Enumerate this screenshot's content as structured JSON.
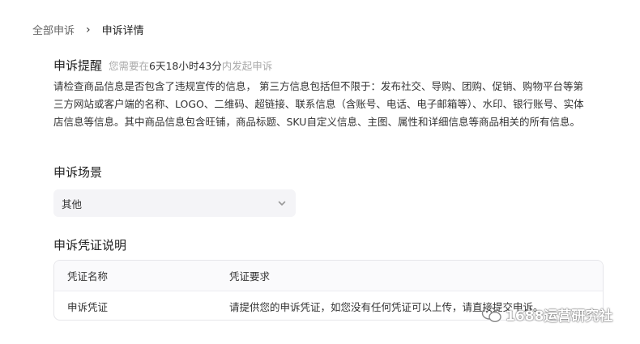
{
  "breadcrumb": {
    "parent": "全部申诉",
    "separator": "›",
    "current": "申诉详情"
  },
  "reminder": {
    "title": "申诉提醒",
    "countdown_prefix": "您需要在",
    "countdown_time": "6天18小时43分",
    "countdown_suffix": "内发起申诉",
    "body": " 请检查商品信息是否包含了违规宣传的信息， 第三方信息包括但不限于：发布社交、导购、团购、促销、购物平台等第三方网站或客户端的名称、LOGO、二维码、超链接、联系信息（含账号、电话、电子邮箱等）、水印、银行账号、实体店信息等信息。其中商品信息包含旺铺，商品标题、SKU自定义信息、主图、属性和详细信息等商品相关的所有信息。"
  },
  "scene": {
    "title": "申诉场景",
    "selected": "其他"
  },
  "evidence": {
    "title": "申诉凭证说明",
    "columns": [
      "凭证名称",
      "凭证要求"
    ],
    "rows": [
      [
        "申诉凭证",
        "请提供您的申诉凭证，如您没有任何凭证可以上传，请直接提交申诉。"
      ]
    ]
  },
  "watermark": {
    "text": "1688运营研究社"
  },
  "colors": {
    "muted_text": "#aaaaaa",
    "select_bg": "#f4f4f7",
    "table_border": "#e6e6ea"
  }
}
